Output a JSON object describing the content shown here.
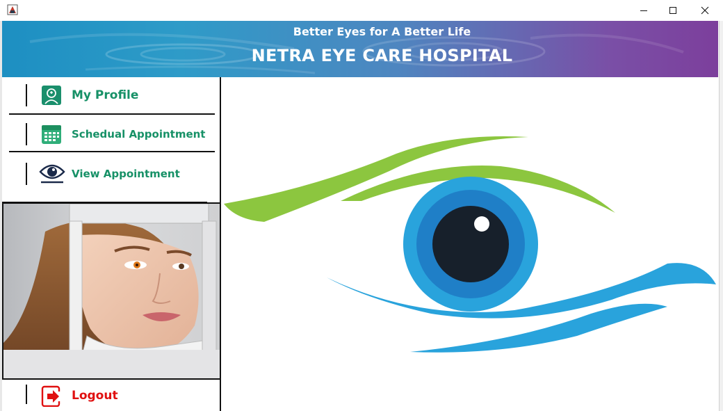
{
  "window": {
    "app_icon": "java-app-icon",
    "controls": [
      "minimize-icon",
      "maximize-icon",
      "close-icon"
    ]
  },
  "header": {
    "tagline": "Better Eyes for A Better Life",
    "title": "NETRA EYE CARE HOSPITAL"
  },
  "sidebar": {
    "items": [
      {
        "label": "My Profile",
        "icon": "profile-icon"
      },
      {
        "label": "Schedual Appointment",
        "icon": "calendar-icon"
      },
      {
        "label": "View Appointment",
        "icon": "eye-icon"
      }
    ],
    "photo": "patient-eye-exam-photo",
    "logout": {
      "label": "Logout",
      "icon": "logout-icon"
    }
  },
  "main": {
    "logo": "eye-logo"
  },
  "colors": {
    "nav_text": "#179167",
    "logout_text": "#e01010",
    "banner_start": "#1d8fc2",
    "banner_end": "#7c3f9c",
    "logo_green": "#8cc63f",
    "logo_blue": "#29a3dc"
  }
}
